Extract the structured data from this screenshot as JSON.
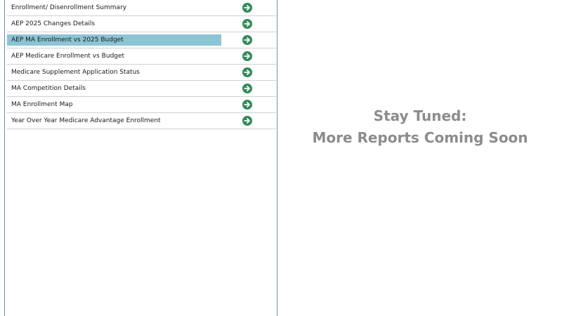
{
  "reports": {
    "items": [
      {
        "label": "Enrollment/ Disenrollment Summary",
        "icon": "arrow-right-circle-icon"
      },
      {
        "label": "AEP 2025 Changes Details",
        "icon": "arrow-right-circle-icon"
      },
      {
        "label": "AEP MA Enrollment vs 2025 Budget",
        "icon": "arrow-right-circle-icon",
        "selected": true
      },
      {
        "label": "AEP Medicare Enrollment vs Budget",
        "icon": "arrow-right-circle-icon"
      },
      {
        "label": "Medicare Supplement Application Status",
        "icon": "arrow-right-circle-icon"
      },
      {
        "label": "MA Competition Details",
        "icon": "arrow-right-circle-icon"
      },
      {
        "label": "MA Enrollment Map",
        "icon": "arrow-right-circle-icon"
      },
      {
        "label": "Year Over Year Medicare Advantage Enrollment",
        "icon": "arrow-right-circle-icon"
      }
    ]
  },
  "announcement": {
    "line1": "Stay Tuned:",
    "line2": "More Reports Coming Soon"
  },
  "colors": {
    "selected_row": "#8cc4d4",
    "icon_green": "#2e8b57",
    "announcement_text": "#8c8c8c",
    "panel_border": "#6f8fa0"
  }
}
